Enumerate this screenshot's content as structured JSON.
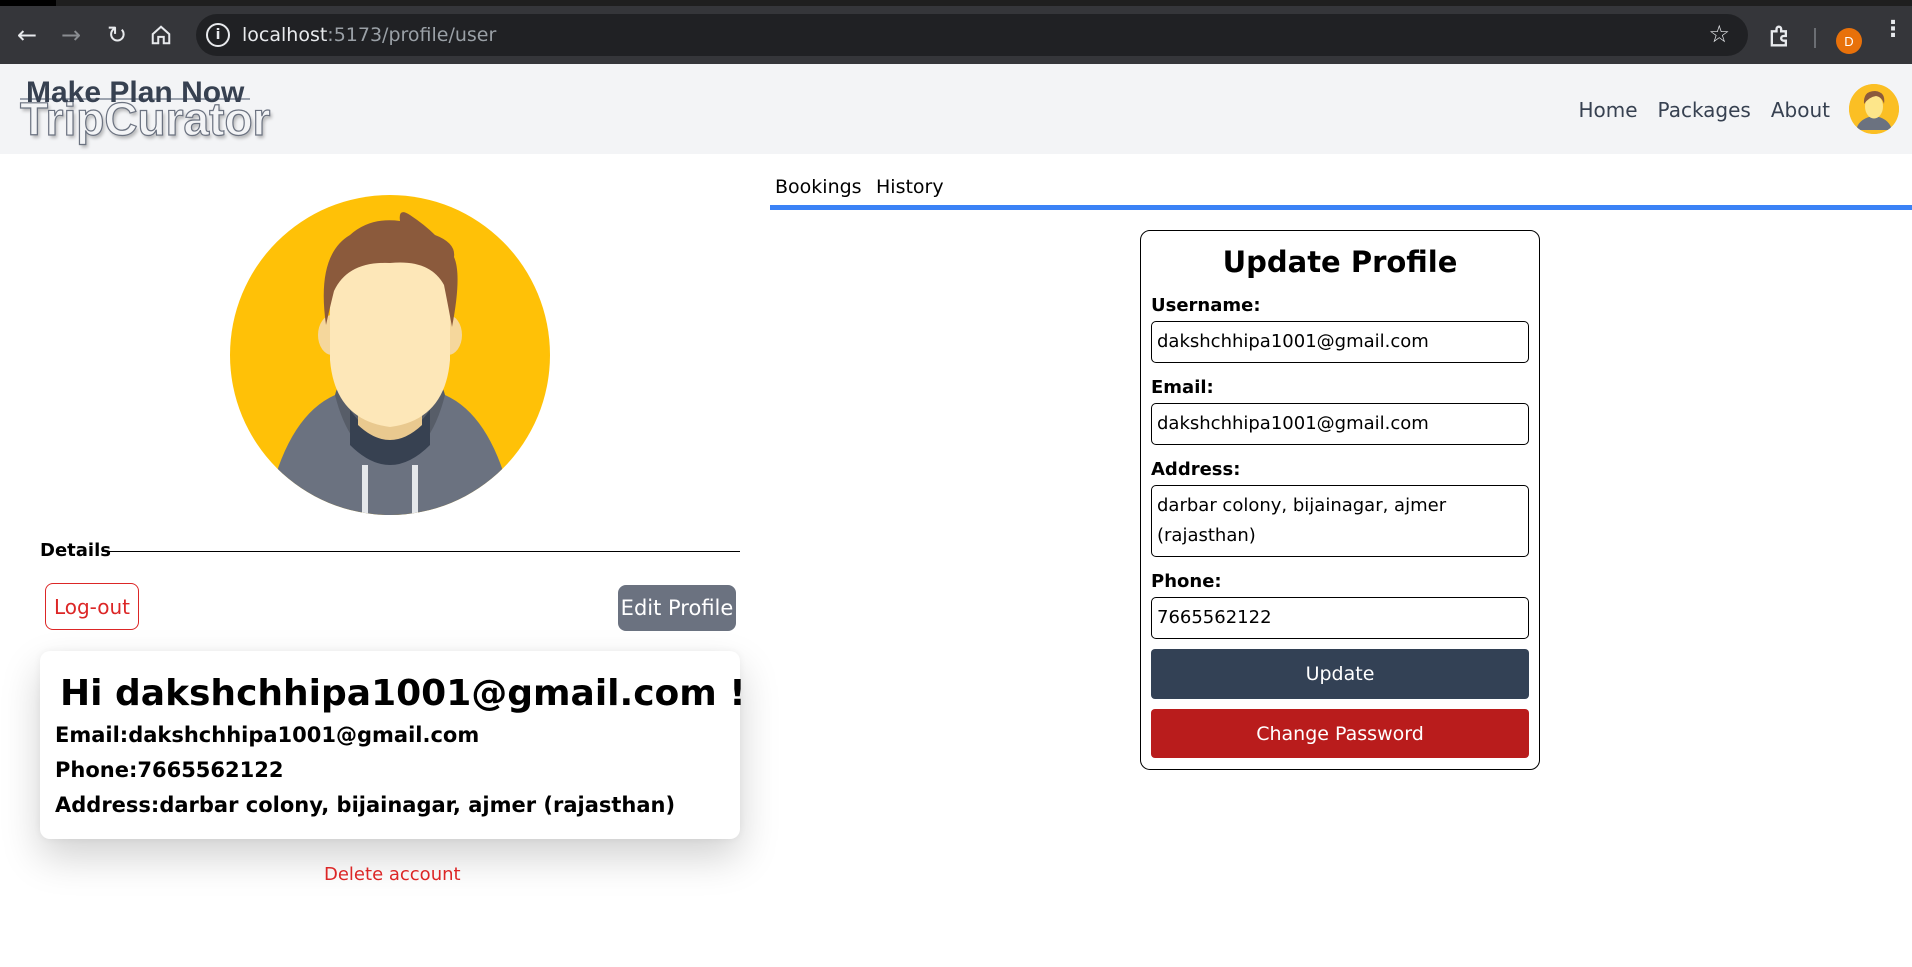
{
  "browser": {
    "url_host": "localhost",
    "url_rest": ":5173/profile/user",
    "profile_initial": "D",
    "icons": [
      "back-icon",
      "forward-icon",
      "reload-icon",
      "home-icon",
      "site-info-icon",
      "bookmark-star-icon",
      "extensions-icon",
      "menu-icon"
    ]
  },
  "navbar": {
    "brand_top": "Make Plan Now",
    "brand_bottom": "TripCurator",
    "links": [
      "Home",
      "Packages",
      "About"
    ]
  },
  "profile": {
    "details_label": "Details",
    "logout_label": "Log-out",
    "edit_label": "Edit Profile",
    "greeting": "Hi dakshchhipa1001@gmail.com !",
    "email_line": "Email:dakshchhipa1001@gmail.com",
    "phone_line": "Phone:7665562122",
    "address_line": "Address:darbar colony, bijainagar, ajmer (rajasthan)",
    "delete_label": "Delete account"
  },
  "tabs": [
    "Bookings",
    "History"
  ],
  "form": {
    "title": "Update Profile",
    "username_label": "Username:",
    "username_value": "dakshchhipa1001@gmail.com",
    "email_label": "Email:",
    "email_value": "dakshchhipa1001@gmail.com",
    "address_label": "Address:",
    "address_value": "darbar colony, bijainagar, ajmer (rajasthan)",
    "phone_label": "Phone:",
    "phone_value": "7665562122",
    "update_label": "Update",
    "change_password_label": "Change Password"
  },
  "colors": {
    "accent_blue": "#3b82f6",
    "danger": "#dc2626",
    "update_button": "#334155",
    "change_password_button": "#b91c1c",
    "avatar_bg": "#fbbf24"
  }
}
